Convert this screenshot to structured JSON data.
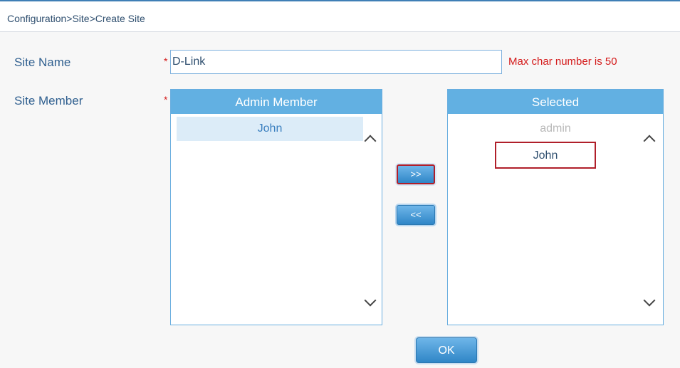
{
  "breadcrumb": "Configuration>Site>Create Site",
  "form": {
    "site_name_label": "Site Name",
    "site_name_value": "D-Link",
    "site_name_hint": "Max char number is 50",
    "site_member_label": "Site Member",
    "required_mark": "*"
  },
  "admin_list": {
    "header": "Admin Member",
    "items": [
      "John"
    ]
  },
  "selected_list": {
    "header": "Selected",
    "items": [
      "admin",
      "John"
    ]
  },
  "buttons": {
    "add": ">>",
    "remove": "<<",
    "ok": "OK"
  },
  "colors": {
    "accent": "#62b0e2",
    "highlight_border": "#b01f2a",
    "hint_red": "#d41a1a"
  }
}
